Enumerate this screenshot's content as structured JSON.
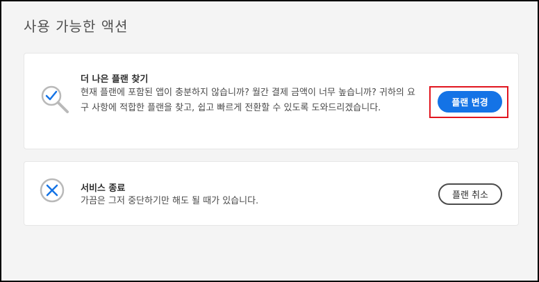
{
  "page": {
    "title": "사용 가능한 액션"
  },
  "cards": [
    {
      "title": "더 나은 플랜 찾기",
      "description": "현재 플랜에 포함된 앱이 충분하지 않습니까? 월간 결제 금액이 너무 높습니까? 귀하의 요구 사항에 적합한 플랜을 찾고, 쉽고 빠르게 전환할 수 있도록 도와드리겠습니다.",
      "button_label": "플랜 변경",
      "icon": "search-check-icon"
    },
    {
      "title": "서비스 종료",
      "description": "가끔은 그저 중단하기만 해도 될 때가 있습니다.",
      "button_label": "플랜 취소",
      "icon": "close-circle-icon"
    }
  ],
  "colors": {
    "accent": "#1473e6",
    "highlight": "#e1141e",
    "background": "#f4f4f4"
  }
}
